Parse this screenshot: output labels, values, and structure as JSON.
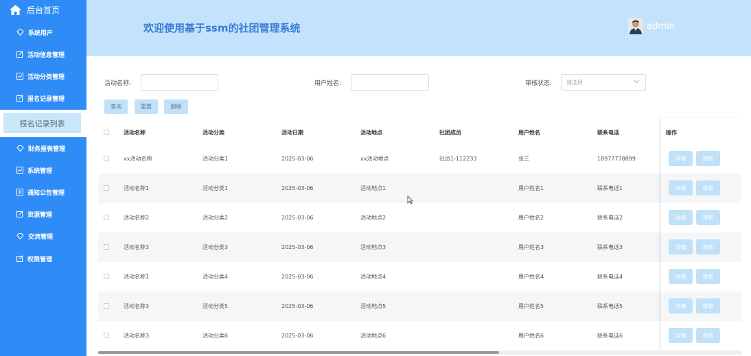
{
  "sidebar": {
    "home_label": "后台首页",
    "items": [
      {
        "label": "系统用户",
        "icon": "diamond-icon"
      },
      {
        "label": "活动信息管理",
        "icon": "edit-icon"
      },
      {
        "label": "活动分类管理",
        "icon": "chart-icon"
      },
      {
        "label": "报名记录管理",
        "icon": "edit-icon"
      },
      {
        "label": "财务报表管理",
        "icon": "diamond-icon"
      },
      {
        "label": "系统管理",
        "icon": "chart-icon"
      },
      {
        "label": "通知公告管理",
        "icon": "notice-icon"
      },
      {
        "label": "资源管理",
        "icon": "edit-icon"
      },
      {
        "label": "交流管理",
        "icon": "diamond-icon"
      },
      {
        "label": "权限管理",
        "icon": "edit-icon"
      }
    ],
    "active_subitem": "报名记录列表"
  },
  "header": {
    "title": "欢迎使用基于ssm的社团管理系统",
    "username": "admin"
  },
  "filters": {
    "activity_name_label": "活动名称:",
    "user_name_label": "用户姓名:",
    "status_label": "审核状态:",
    "status_placeholder": "请选择",
    "query_button": "查询",
    "reset_button": "重置",
    "delete_button": "删除"
  },
  "table": {
    "headers": [
      "活动名称",
      "活动分类",
      "活动日期",
      "活动地点",
      "社团成员",
      "用户姓名",
      "联系电话",
      "操作"
    ],
    "rows": [
      [
        "xx活动名称",
        "活动分类1",
        "2025-03-06",
        "xx活动地点",
        "社员1-112233",
        "张三",
        "18977778899"
      ],
      [
        "活动名称1",
        "活动分类1",
        "2025-03-06",
        "活动地点1",
        "",
        "用户姓名1",
        "联系电话1"
      ],
      [
        "活动名称2",
        "活动分类2",
        "2025-03-06",
        "活动地点2",
        "",
        "用户姓名2",
        "联系电话2"
      ],
      [
        "活动名称3",
        "活动分类3",
        "2025-03-06",
        "活动地点3",
        "",
        "用户姓名3",
        "联系电话3"
      ],
      [
        "活动名称1",
        "活动分类4",
        "2025-03-06",
        "活动地点4",
        "",
        "用户姓名4",
        "联系电话4"
      ],
      [
        "活动名称3",
        "活动分类5",
        "2025-03-06",
        "活动地点5",
        "",
        "用户姓名5",
        "联系电话5"
      ],
      [
        "活动名称3",
        "活动分类6",
        "2025-03-06",
        "活动地点6",
        "",
        "用户姓名6",
        "联系电话6"
      ]
    ],
    "detail_button": "详情",
    "review_button": "审核"
  }
}
